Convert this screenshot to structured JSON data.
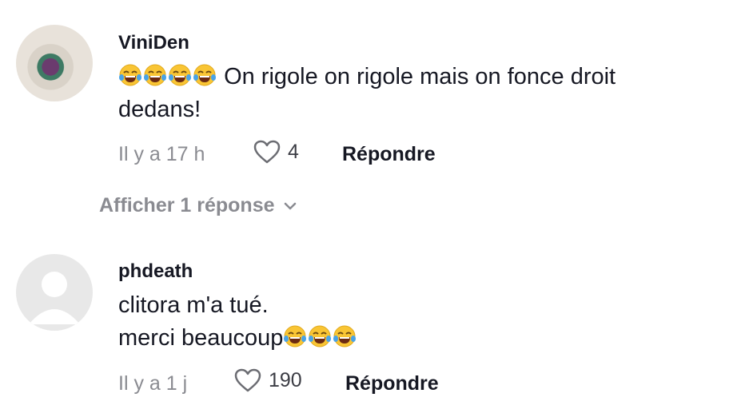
{
  "comments": [
    {
      "username": "ViniDen",
      "text_line1_emojis": "😂😂😂😂",
      "text_line1": "On rigole on rigole mais on fonce droit",
      "text_line2": "dedans!",
      "time": "Il y a 17 h",
      "likes": "4",
      "reply_label": "Répondre"
    },
    {
      "username": "phdeath",
      "text_line1": "clitora m'a tué.",
      "text_line2": "merci beaucoup",
      "text_line2_emojis": "😂😂😂",
      "time": "Il y a 1 j",
      "likes": "190",
      "reply_label": "Répondre"
    }
  ],
  "show_replies_label": "Afficher 1 réponse",
  "icons": {
    "heart": "heart-outline-icon",
    "chevron": "chevron-down-icon",
    "emoji": "face-with-tears-of-joy"
  },
  "colors": {
    "meta_grey": "#8a8b91",
    "text": "#161823"
  }
}
